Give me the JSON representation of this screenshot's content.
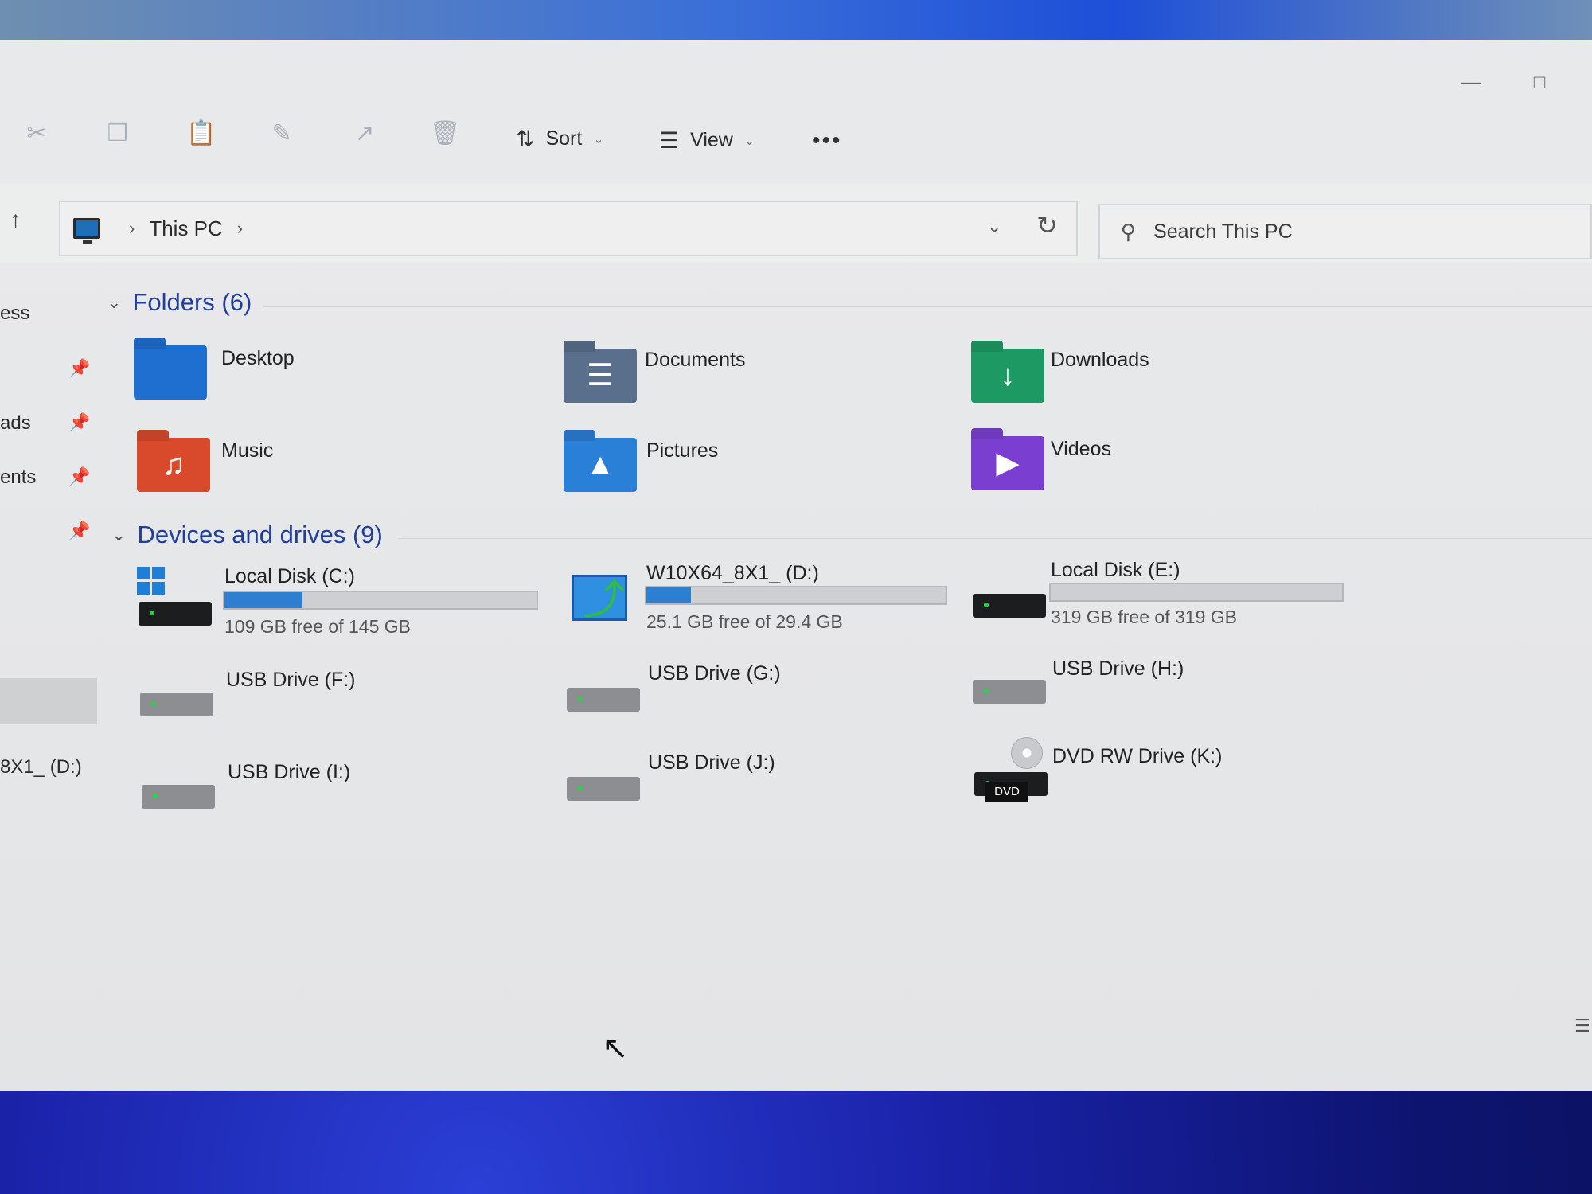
{
  "toolbar": {
    "sort_label": "Sort",
    "view_label": "View",
    "more_label": "•••",
    "icons": [
      "cut-icon",
      "copy-icon",
      "paste-icon",
      "rename-icon",
      "share-icon",
      "delete-icon"
    ]
  },
  "address": {
    "crumbs": [
      "This PC"
    ],
    "search_placeholder": "Search This PC"
  },
  "sidebar": {
    "items": [
      {
        "label": "ess"
      },
      {
        "label": "ads"
      },
      {
        "label": "ents"
      },
      {
        "label": "8X1_ (D:)"
      }
    ]
  },
  "folders": {
    "heading": "Folders (6)",
    "items": [
      {
        "name": "Desktop",
        "color": "#1f6fd0",
        "icon": "desktop-folder-icon"
      },
      {
        "name": "Documents",
        "color": "#5a6f8c",
        "icon": "documents-folder-icon"
      },
      {
        "name": "Downloads",
        "color": "#1d9a63",
        "icon": "downloads-folder-icon"
      },
      {
        "name": "Music",
        "color": "#d94a2c",
        "icon": "music-folder-icon"
      },
      {
        "name": "Pictures",
        "color": "#2a7fd6",
        "icon": "pictures-folder-icon"
      },
      {
        "name": "Videos",
        "color": "#7a3fd0",
        "icon": "videos-folder-icon"
      }
    ]
  },
  "drives": {
    "heading": "Devices and drives (9)",
    "items": [
      {
        "name": "Local Disk (C:)",
        "free_text": "109 GB free of 145 GB",
        "used_fraction": 0.25
      },
      {
        "name": "W10X64_8X1_ (D:)",
        "free_text": "25.1 GB free of 29.4 GB",
        "used_fraction": 0.15
      },
      {
        "name": "Local Disk (E:)",
        "free_text": "319 GB free of 319 GB",
        "used_fraction": 0.0
      },
      {
        "name": "USB Drive (F:)"
      },
      {
        "name": "USB Drive (G:)"
      },
      {
        "name": "USB Drive (H:)"
      },
      {
        "name": "USB Drive (I:)"
      },
      {
        "name": "USB Drive (J:)"
      },
      {
        "name": "DVD RW Drive (K:)",
        "badge": "DVD"
      }
    ]
  },
  "colors": {
    "accent": "#2f7fd1",
    "section_heading": "#1f3f9a"
  }
}
